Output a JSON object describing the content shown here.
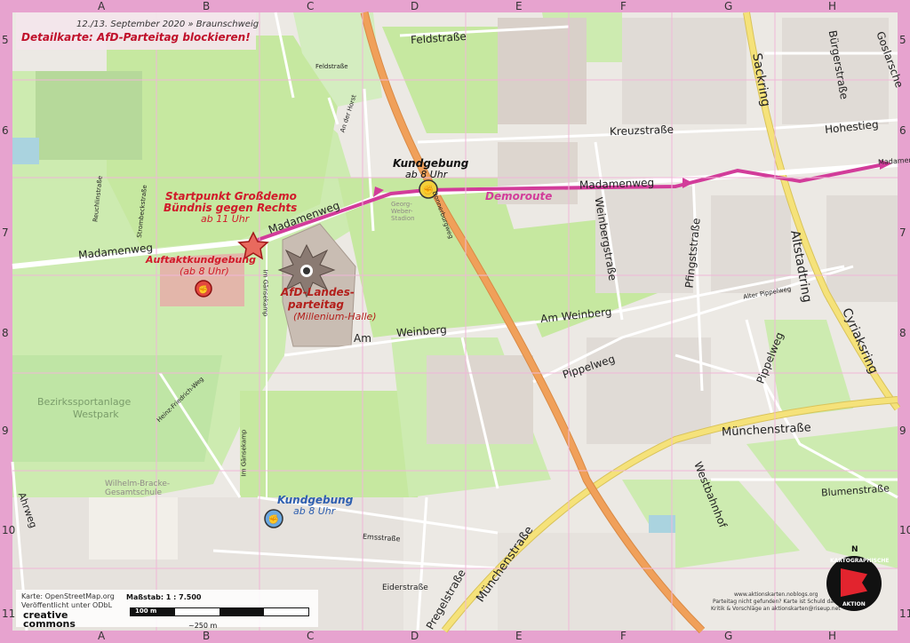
{
  "header": {
    "date": "12./13. September 2020 » Braunschweig",
    "title": "Detailkarte: AfD-Parteitag blockieren!"
  },
  "grid": {
    "columns": [
      "A",
      "B",
      "C",
      "D",
      "E",
      "F",
      "G",
      "H"
    ],
    "rows": [
      "5",
      "6",
      "7",
      "8",
      "9",
      "10",
      "11"
    ]
  },
  "streets": {
    "madamenweg_w": "Madamenweg",
    "madamenweg_c": "Madamenweg",
    "madamenweg_e": "Madamenweg",
    "madamenweg_far": "Madamen",
    "feldstrasse_n": "Feldstraße",
    "feldstrasse_small": "Feldstraße",
    "kreuzstrasse": "Kreuzstraße",
    "hohestieg": "Hohestieg",
    "sackring": "Sackring",
    "burgerstrasse": "Bürgerstraße",
    "goslarsche": "Goslarsche",
    "altstadtring": "Altstadtring",
    "cyriaksring": "Cyriaksring",
    "am_weinberg_a": "Am",
    "am_weinberg_b": "Weinberg",
    "am_weinberg_e": "Am Weinberg",
    "pippelweg_e": "Pippelweg",
    "pippelweg_g": "Pippelweg",
    "weinbergstrasse": "Weinbergstraße",
    "pfingststrasse": "Pfingststraße",
    "muenchenstrasse_g": "Münchenstraße",
    "muenchenstrasse_e": "Münchenstraße",
    "westbahnhof": "Westbahnhof",
    "blumenstrasse": "Blumenstraße",
    "pregelstrasse": "Pregelstraße",
    "eiderstrasse": "Eiderstraße",
    "emsstrasse": "Emsstraße",
    "ahrweg": "Ahrweg",
    "im_gaensekamp": "Im Gänsekamp",
    "im_gaensekamp2": "Im Gänsekamp",
    "heinz_friedrich_weg": "Heinz-Friedrich-Weg",
    "reuchlinstrasse": "Reuchlinstraße",
    "strombeckstrasse": "Strombeckstraße",
    "an_der_horst": "An der Horst",
    "alter_pippelweg": "Alter Pippelweg",
    "donnerburgweg": "Donnerburgweg"
  },
  "places": {
    "bezirkssportanlage": "Bezirkssportanlage",
    "westpark": "Westpark",
    "wilhelm_bracke": "Wilhelm-Bracke-Gesamtschule",
    "weber_stadion": "Georg-Weber-Stadion"
  },
  "annotations": {
    "startpunkt_1": "Startpunkt Großdemo",
    "startpunkt_2": "Bündnis gegen Rechts",
    "startpunkt_time": "ab 11 Uhr",
    "auftakt": "Auftaktkundgebung",
    "auftakt_time": "(ab 8 Uhr)",
    "afd_1": "AfD-Landes-",
    "afd_2": "parteitag",
    "afd_3": "(Millenium-Halle)",
    "kund_yellow": "Kundgebung",
    "kund_yellow_time": "ab 8 Uhr",
    "kund_blue": "Kundgebung",
    "kund_blue_time": "ab 8 Uhr",
    "demoroute": "Demoroute"
  },
  "footer": {
    "credit_1": "Karte: OpenStreetMap.org",
    "credit_2": "Veröffentlicht unter ODbL",
    "cc": "creative commons",
    "scale": "Maßstab: 1 : 7.500",
    "scale_bar": "100 m",
    "scale_250": "~250 m",
    "right_1": "www.aktionskarten.noblogs.org",
    "right_2": "Parteitag nicht gefunden? Karte ist Schuld daran.",
    "right_3": "Kritik & Vorschläge an aktionskarten@riseup.net",
    "logo_top": "KARTOGRAPHISCHE",
    "logo_bottom": "AKTION",
    "compass_n": "N"
  },
  "colors": {
    "frame": "#e7a3cf",
    "demo_route": "#d23c9a",
    "motorway": "#f0a05a",
    "trunk": "#f5e27a",
    "park": "#cdebb0",
    "allotments": "#c6e8a0",
    "forest": "#add19e",
    "residential": "#e0dfdf",
    "building": "#d9d0c9"
  }
}
